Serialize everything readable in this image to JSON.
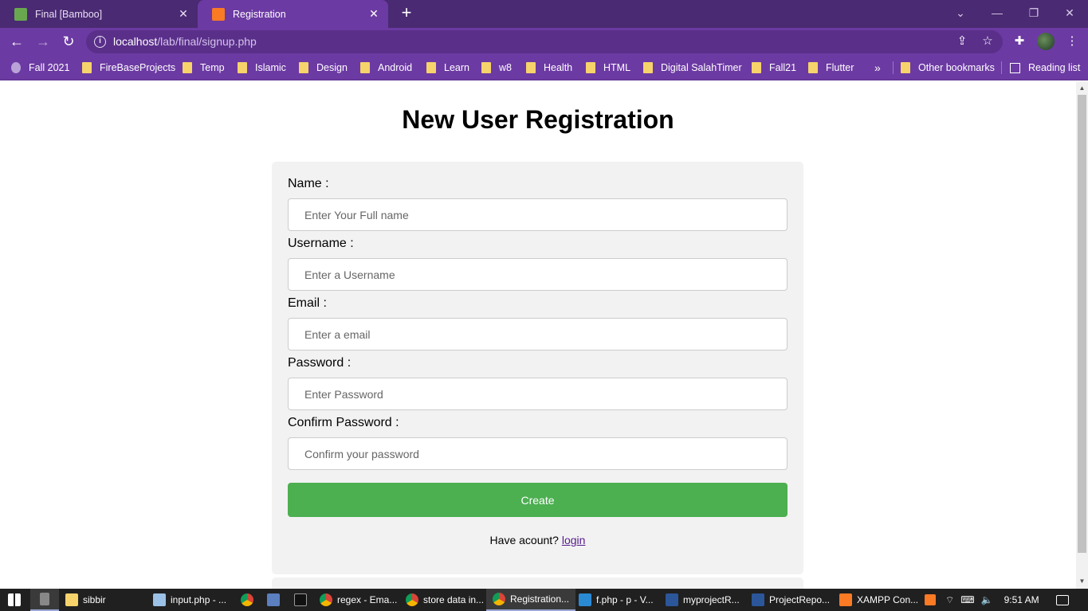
{
  "browser": {
    "tabs": [
      {
        "title": "Final [Bamboo]",
        "icon": "bamboo-icon",
        "active": false
      },
      {
        "title": "Registration",
        "icon": "xampp-icon",
        "active": true
      }
    ],
    "url_host": "localhost",
    "url_path": "/lab/final/signup.php",
    "bookmarks": [
      "Fall 2021",
      "FireBaseProjects",
      "Temp",
      "Islamic",
      "Design",
      "Android",
      "Learn",
      "w8",
      "Health",
      "HTML",
      "Digital SalahTimer",
      "Fall21",
      "Flutter"
    ],
    "more_bookmarks": "»",
    "other_bookmarks": "Other bookmarks",
    "reading_list": "Reading list",
    "theme_color": "#6c3aa3"
  },
  "page": {
    "heading": "New User Registration",
    "fields": [
      {
        "label": "Name :",
        "placeholder": "Enter Your Full name"
      },
      {
        "label": "Username :",
        "placeholder": "Enter a Username"
      },
      {
        "label": "Email :",
        "placeholder": "Enter a email"
      },
      {
        "label": "Password :",
        "placeholder": "Enter Password"
      },
      {
        "label": "Confirm Password :",
        "placeholder": "Confirm your password"
      }
    ],
    "submit_label": "Create",
    "login_prompt": "Have acount?",
    "login_link": "login",
    "button_color": "#4caf50"
  },
  "taskbar": {
    "items": [
      {
        "label": "sibbir",
        "icon": "folder-icon"
      },
      {
        "label": "input.php - ...",
        "icon": "notepad-icon"
      },
      {
        "label": "",
        "icon": "chrome-icon"
      },
      {
        "label": "",
        "icon": "app-icon"
      },
      {
        "label": "",
        "icon": "terminal-icon"
      },
      {
        "label": "regex - Ema...",
        "icon": "chrome-icon"
      },
      {
        "label": "store data in...",
        "icon": "chrome-icon"
      },
      {
        "label": "Registration...",
        "icon": "chrome-icon"
      },
      {
        "label": "f.php - p - V...",
        "icon": "vscode-icon"
      },
      {
        "label": "myprojectR...",
        "icon": "word-icon"
      },
      {
        "label": "ProjectRepo...",
        "icon": "word-icon"
      },
      {
        "label": "XAMPP Con...",
        "icon": "xampp-icon"
      }
    ],
    "time": "9:51 AM"
  }
}
